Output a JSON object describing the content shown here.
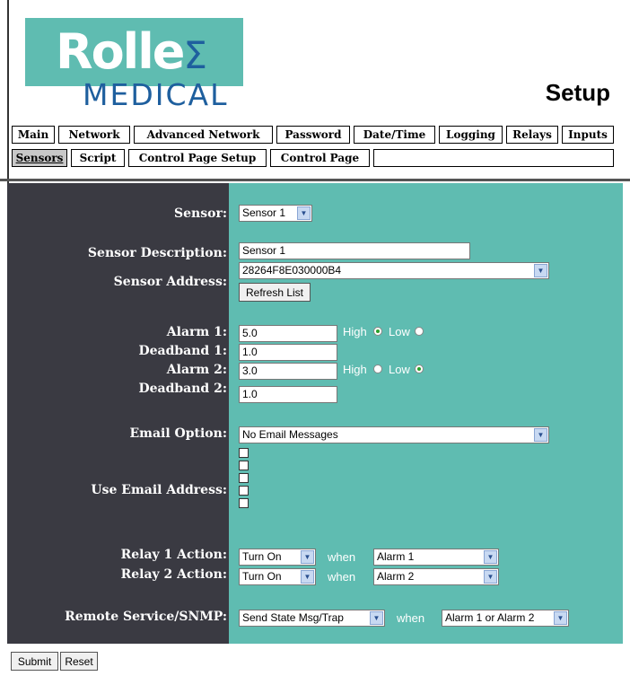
{
  "header": {
    "logo_word": "Rolle",
    "logo_glyph": "Σ",
    "logo_sub": "MEDICAL",
    "title": "Setup"
  },
  "tabs_row1": [
    "Main",
    "Network",
    "Advanced Network",
    "Password",
    "Date/Time",
    "Logging",
    "Relays",
    "Inputs"
  ],
  "tabs_row2": [
    "Sensors",
    "Script",
    "Control Page Setup",
    "Control Page"
  ],
  "active_tab": "Sensors",
  "form": {
    "sensor": {
      "label": "Sensor:",
      "value": "Sensor 1"
    },
    "sensor_description": {
      "label": "Sensor Description:",
      "value": "Sensor 1"
    },
    "sensor_address": {
      "label": "Sensor Address:",
      "value": "28264F8E030000B4",
      "refresh": "Refresh List"
    },
    "alarm1": {
      "label": "Alarm 1:",
      "value": "5.0",
      "selected": "High"
    },
    "deadband1": {
      "label": "Deadband 1:",
      "value": "1.0"
    },
    "alarm2": {
      "label": "Alarm 2:",
      "value": "3.0",
      "selected": "Low"
    },
    "deadband2": {
      "label": "Deadband 2:",
      "value": "1.0"
    },
    "high_label": "High",
    "low_label": "Low",
    "email_option": {
      "label": "Email Option:",
      "value": "No Email Messages"
    },
    "use_email": {
      "label": "Use Email Address:",
      "count": 5
    },
    "relay1": {
      "label": "Relay 1 Action:",
      "action": "Turn On",
      "when": "when",
      "condition": "Alarm 1"
    },
    "relay2": {
      "label": "Relay 2 Action:",
      "action": "Turn On",
      "when": "when",
      "condition": "Alarm 2"
    },
    "remote": {
      "label": "Remote Service/SNMP:",
      "action": "Send State Msg/Trap",
      "when": "when",
      "condition": "Alarm 1 or Alarm 2"
    }
  },
  "buttons": {
    "submit": "Submit",
    "reset": "Reset"
  },
  "colors": {
    "teal": "#5fbcb1",
    "dark": "#3a3a42",
    "logo_blue": "#1e5f9e"
  }
}
